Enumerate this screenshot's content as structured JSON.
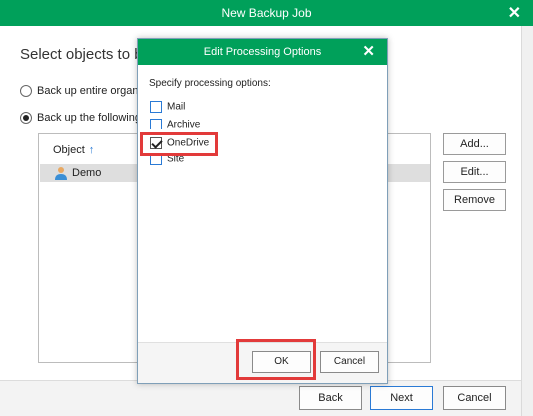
{
  "window": {
    "title": "New Backup Job"
  },
  "page": {
    "heading": "Select objects to back up",
    "radio_all": "Back up entire organization",
    "radio_following": "Back up the following objects:"
  },
  "objects_list": {
    "column_header": "Object",
    "rows": [
      {
        "label": "Demo",
        "icon": "user-icon"
      }
    ]
  },
  "side_buttons": {
    "add": "Add...",
    "edit": "Edit...",
    "remove": "Remove"
  },
  "footer": {
    "back": "Back",
    "next": "Next",
    "cancel": "Cancel"
  },
  "dialog": {
    "title": "Edit Processing Options",
    "label": "Specify processing options:",
    "options": [
      {
        "label": "Mail",
        "checked": false
      },
      {
        "label": "Archive",
        "checked": false
      },
      {
        "label": "OneDrive",
        "checked": true
      },
      {
        "label": "Site",
        "checked": false
      }
    ],
    "ok": "OK",
    "cancel": "Cancel"
  },
  "colors": {
    "titlebar": "#00a05a",
    "highlight": "#e23a3a",
    "accent": "#2a7ad5"
  }
}
